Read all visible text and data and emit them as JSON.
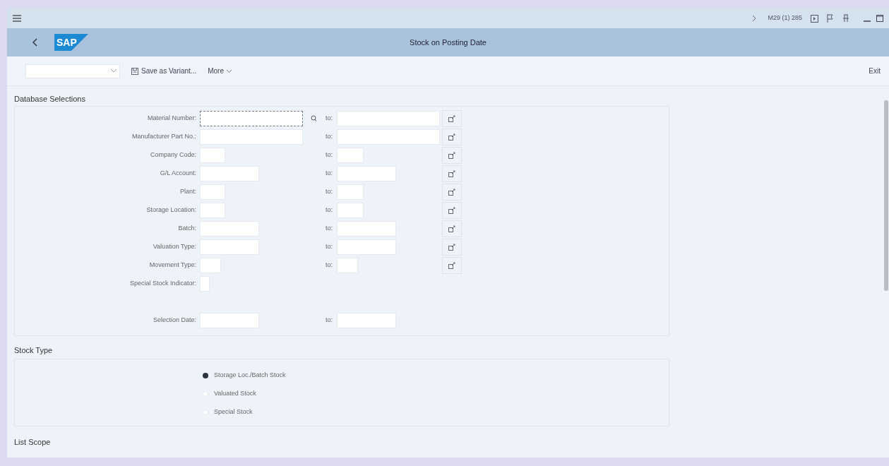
{
  "shell": {
    "system_info": "M29 (1) 285"
  },
  "header": {
    "logo": "SAP",
    "title": "Stock on Posting Date"
  },
  "toolbar": {
    "buttons": [
      {
        "kind": "save",
        "label": "Save as Variant..."
      },
      {
        "kind": "more",
        "label": "More"
      }
    ],
    "exit": "Exit"
  },
  "database_selections": {
    "title": "Database Selections",
    "rows": [
      {
        "label": "Material Number:",
        "to": "to:",
        "focused": true,
        "value_help": true,
        "multiple": true
      },
      {
        "label": "Manufacturer Part No.:",
        "to": "to:",
        "focused": false,
        "value_help": false,
        "multiple": true
      },
      {
        "label": "Company Code:",
        "to": "to:",
        "focused": false,
        "value_help": false,
        "multiple": true
      },
      {
        "label": "G/L Account:",
        "to": "to:",
        "focused": false,
        "value_help": false,
        "multiple": true
      },
      {
        "label": "Plant:",
        "to": "to:",
        "focused": false,
        "value_help": false,
        "multiple": true
      },
      {
        "label": "Storage Location:",
        "to": "to:",
        "focused": false,
        "value_help": false,
        "multiple": true
      },
      {
        "label": "Batch:",
        "to": "to:",
        "focused": false,
        "value_help": false,
        "multiple": true
      },
      {
        "label": "Valuation Type:",
        "to": "to:",
        "focused": false,
        "value_help": false,
        "multiple": true
      },
      {
        "label": "Movement Type:",
        "to": "to:",
        "focused": false,
        "value_help": false,
        "multiple": true
      },
      {
        "label": "Special Stock Indicator:",
        "focused": false,
        "value_help": false,
        "multiple": false
      }
    ],
    "selection_date": {
      "label": "Selection Date:",
      "to": "to:"
    }
  },
  "stock_type": {
    "title": "Stock Type",
    "options": [
      {
        "label": "Storage Loc./Batch Stock",
        "selected": true
      },
      {
        "label": "Valuated Stock",
        "selected": false
      },
      {
        "label": "Special Stock",
        "selected": false
      }
    ]
  },
  "list_scope": {
    "title": "List Scope"
  }
}
